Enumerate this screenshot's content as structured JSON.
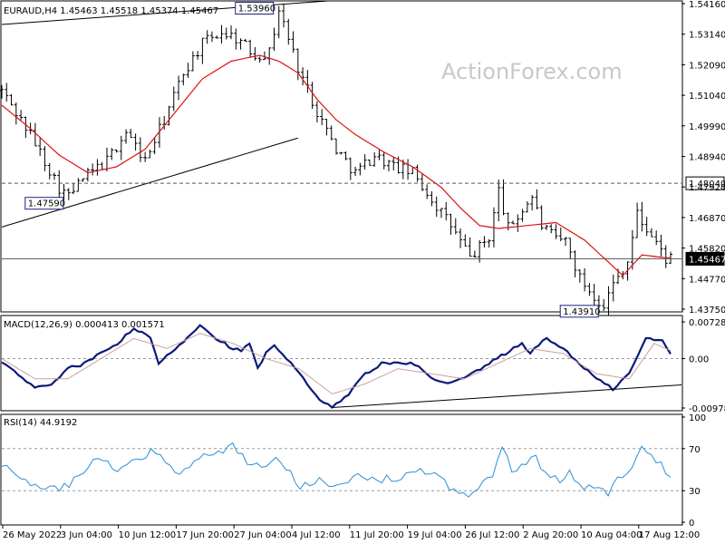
{
  "colors": {
    "price": "#000000",
    "ma": "#dd1111",
    "macd": "#0b1a7a",
    "macd_signal": "#c8a0a0",
    "rsi": "#2a8fd6",
    "watermark": "#c8c8c8",
    "grid": "#9a9a9a"
  },
  "watermark": "ActionForex.com",
  "chart_data": [
    {
      "type": "line",
      "title": "EURAUD,H4  1.45463 1.45518 1.45374 1.45467",
      "ylim": [
        1.4375,
        1.5416
      ],
      "y_ticks": [
        "1.54160",
        "1.53140",
        "1.52090",
        "1.51040",
        "1.49990",
        "1.48940",
        "1.47920",
        "1.46870",
        "1.45820",
        "1.44770",
        "1.43750"
      ],
      "x_ticks": [
        "26 May 2022",
        "3 Jun 04:00",
        "10 Jun 12:00",
        "17 Jun 20:00",
        "27 Jun 04:00",
        "4 Jul 12:00",
        "11 Jul 20:00",
        "19 Jul 04:00",
        "26 Jul 12:00",
        "2 Aug 20:00",
        "10 Aug 04:00",
        "17 Aug 12:00"
      ],
      "n_bars": 120,
      "price_anchors": [
        [
          0,
          1.512
        ],
        [
          6,
          1.497
        ],
        [
          12,
          1.479
        ],
        [
          14,
          1.4759
        ],
        [
          17,
          1.482
        ],
        [
          22,
          1.488
        ],
        [
          26,
          1.498
        ],
        [
          30,
          1.488
        ],
        [
          34,
          1.502
        ],
        [
          38,
          1.518
        ],
        [
          42,
          1.528
        ],
        [
          46,
          1.532
        ],
        [
          49,
          1.53
        ],
        [
          53,
          1.524
        ],
        [
          56,
          1.525
        ],
        [
          58,
          1.5396
        ],
        [
          62,
          1.52
        ],
        [
          66,
          1.505
        ],
        [
          70,
          1.492
        ],
        [
          74,
          1.484
        ],
        [
          78,
          1.49
        ],
        [
          82,
          1.486
        ],
        [
          86,
          1.484
        ],
        [
          90,
          1.475
        ],
        [
          94,
          1.466
        ],
        [
          98,
          1.455
        ],
        [
          102,
          1.462
        ],
        [
          104,
          1.478
        ],
        [
          106,
          1.465
        ],
        [
          108,
          1.469
        ],
        [
          111,
          1.476
        ],
        [
          113,
          1.466
        ],
        [
          116,
          1.461
        ],
        [
          118,
          1.461
        ],
        [
          121,
          1.448
        ],
        [
          124,
          1.442
        ],
        [
          126,
          1.4391
        ],
        [
          128,
          1.446
        ],
        [
          131,
          1.454
        ],
        [
          133,
          1.47
        ],
        [
          134,
          1.467
        ],
        [
          137,
          1.46
        ],
        [
          139,
          1.4547
        ]
      ],
      "moving_average": [
        [
          0,
          1.507
        ],
        [
          6,
          1.499
        ],
        [
          12,
          1.49
        ],
        [
          18,
          1.484
        ],
        [
          24,
          1.486
        ],
        [
          30,
          1.492
        ],
        [
          36,
          1.504
        ],
        [
          42,
          1.516
        ],
        [
          48,
          1.522
        ],
        [
          54,
          1.524
        ],
        [
          58,
          1.522
        ],
        [
          62,
          1.518
        ],
        [
          66,
          1.509
        ],
        [
          70,
          1.502
        ],
        [
          74,
          1.497
        ],
        [
          80,
          1.491
        ],
        [
          86,
          1.486
        ],
        [
          92,
          1.479
        ],
        [
          96,
          1.472
        ],
        [
          100,
          1.466
        ],
        [
          104,
          1.465
        ],
        [
          110,
          1.466
        ],
        [
          116,
          1.467
        ],
        [
          122,
          1.461
        ],
        [
          126,
          1.455
        ],
        [
          130,
          1.449
        ],
        [
          134,
          1.456
        ],
        [
          139,
          1.455
        ]
      ],
      "trendlines": [
        {
          "from": [
            0,
            1.5345
          ],
          "to": [
            68,
            1.5425
          ]
        },
        {
          "from": [
            0,
            1.4655
          ],
          "to": [
            62,
            1.4958
          ]
        }
      ],
      "horizontal_lines": [
        {
          "value": 1.4804,
          "label": "1.48040",
          "style": "dashed"
        },
        {
          "value": 1.45467,
          "label": "1.45467",
          "style": "current"
        }
      ],
      "annotations": [
        {
          "x": 58,
          "y": 1.5396,
          "text": "1.53960"
        },
        {
          "x": 14,
          "y": 1.4759,
          "text": "1.47590"
        },
        {
          "x": 126,
          "y": 1.4391,
          "text": "1.43910"
        }
      ]
    },
    {
      "type": "line",
      "title": "MACD(12,26,9) 0.000413 0.001571",
      "ylim": [
        -0.009787,
        0.007282
      ],
      "y_ticks": [
        "0.007282",
        "0.00",
        "-0.009787"
      ],
      "series": [
        {
          "name": "MACD",
          "anchors": [
            [
              0,
              -0.001
            ],
            [
              4,
              -0.003
            ],
            [
              8,
              -0.006
            ],
            [
              12,
              -0.005
            ],
            [
              16,
              -0.002
            ],
            [
              20,
              -0.001
            ],
            [
              24,
              0.001
            ],
            [
              28,
              0.003
            ],
            [
              32,
              0.006
            ],
            [
              36,
              0.004
            ],
            [
              38,
              -0.001
            ],
            [
              42,
              0.002
            ],
            [
              46,
              0.005
            ],
            [
              48,
              0.0068
            ],
            [
              52,
              0.004
            ],
            [
              56,
              0.002
            ],
            [
              58,
              0.0015
            ],
            [
              60,
              0.003
            ],
            [
              62,
              -0.002
            ],
            [
              64,
              0.001
            ],
            [
              66,
              0.0025
            ],
            [
              70,
              -0.001
            ],
            [
              74,
              -0.005
            ],
            [
              78,
              -0.009
            ],
            [
              80,
              -0.0095
            ],
            [
              84,
              -0.007
            ],
            [
              88,
              -0.003
            ],
            [
              92,
              -0.001
            ],
            [
              96,
              -0.001
            ],
            [
              100,
              -0.001
            ],
            [
              104,
              -0.004
            ],
            [
              108,
              -0.005
            ],
            [
              112,
              -0.004
            ],
            [
              116,
              -0.002
            ],
            [
              118,
              -0.001
            ],
            [
              122,
              0.001
            ],
            [
              126,
              0.003
            ],
            [
              128,
              0.0012
            ],
            [
              132,
              0.004
            ],
            [
              136,
              0.002
            ],
            [
              140,
              -0.001
            ],
            [
              144,
              -0.004
            ],
            [
              148,
              -0.006
            ],
            [
              152,
              -0.003
            ],
            [
              156,
              0.004
            ],
            [
              160,
              0.0035
            ],
            [
              162,
              0.001
            ]
          ]
        },
        {
          "name": "Signal",
          "anchors": [
            [
              0,
              0.0
            ],
            [
              8,
              -0.004
            ],
            [
              16,
              -0.004
            ],
            [
              24,
              0.0
            ],
            [
              32,
              0.004
            ],
            [
              40,
              0.002
            ],
            [
              48,
              0.005
            ],
            [
              56,
              0.003
            ],
            [
              64,
              0.0
            ],
            [
              72,
              -0.002
            ],
            [
              80,
              -0.007
            ],
            [
              88,
              -0.005
            ],
            [
              96,
              -0.002
            ],
            [
              104,
              -0.003
            ],
            [
              112,
              -0.004
            ],
            [
              120,
              -0.001
            ],
            [
              128,
              0.002
            ],
            [
              136,
              0.001
            ],
            [
              144,
              -0.003
            ],
            [
              152,
              -0.004
            ],
            [
              158,
              0.003
            ],
            [
              162,
              0.0016
            ]
          ]
        }
      ],
      "trendline": {
        "from": [
          80,
          -0.0097
        ],
        "to": [
          180,
          -0.0052
        ]
      }
    },
    {
      "type": "line",
      "title": "RSI(14) 44.9192",
      "ylim": [
        0,
        100
      ],
      "y_ticks": [
        "100",
        "70",
        "30",
        "0"
      ],
      "levels": [
        70,
        30
      ],
      "series": [
        {
          "name": "RSI(14)",
          "anchors": [
            [
              0,
              55
            ],
            [
              6,
              38
            ],
            [
              12,
              30
            ],
            [
              16,
              44
            ],
            [
              20,
              62
            ],
            [
              24,
              48
            ],
            [
              28,
              60
            ],
            [
              32,
              68
            ],
            [
              36,
              46
            ],
            [
              40,
              58
            ],
            [
              44,
              66
            ],
            [
              48,
              73
            ],
            [
              52,
              52
            ],
            [
              56,
              56
            ],
            [
              58,
              60
            ],
            [
              62,
              35
            ],
            [
              66,
              42
            ],
            [
              70,
              32
            ],
            [
              74,
              44
            ],
            [
              78,
              40
            ],
            [
              82,
              42
            ],
            [
              86,
              50
            ],
            [
              90,
              44
            ],
            [
              94,
              30
            ],
            [
              98,
              27
            ],
            [
              102,
              45
            ],
            [
              104,
              72
            ],
            [
              106,
              48
            ],
            [
              108,
              56
            ],
            [
              111,
              60
            ],
            [
              113,
              44
            ],
            [
              116,
              40
            ],
            [
              118,
              46
            ],
            [
              121,
              34
            ],
            [
              124,
              32
            ],
            [
              126,
              28
            ],
            [
              128,
              40
            ],
            [
              131,
              55
            ],
            [
              133,
              72
            ],
            [
              134,
              66
            ],
            [
              137,
              54
            ],
            [
              139,
              45
            ]
          ]
        }
      ]
    }
  ]
}
